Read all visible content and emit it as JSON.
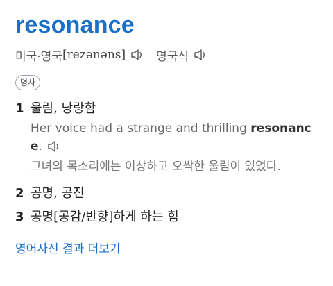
{
  "entry": {
    "headword": "resonance",
    "pron_region": "미국·영국",
    "pron_phonetic": "[rezənəns]",
    "pron_region_uk": "영국식",
    "part_of_speech": "명사"
  },
  "senses": [
    {
      "number": "1",
      "meaning": "울림, 낭랑함",
      "example_en_before": "Her voice had a strange and thrilling ",
      "example_en_highlight": "resonance",
      "example_en_after": ".",
      "example_ko": "그녀의 목소리에는 이상하고 오싹한 울림이 있었다."
    },
    {
      "number": "2",
      "meaning": "공명, 공진"
    },
    {
      "number": "3",
      "meaning": "공명[공감/반향]하게 하는 힘"
    }
  ],
  "more_link": "영어사전 결과 더보기",
  "icons": {
    "speaker": "speaker-icon"
  },
  "colors": {
    "headword": "#1a6fc9",
    "link": "#1a6fc9",
    "text": "#222222",
    "muted": "#777777"
  }
}
